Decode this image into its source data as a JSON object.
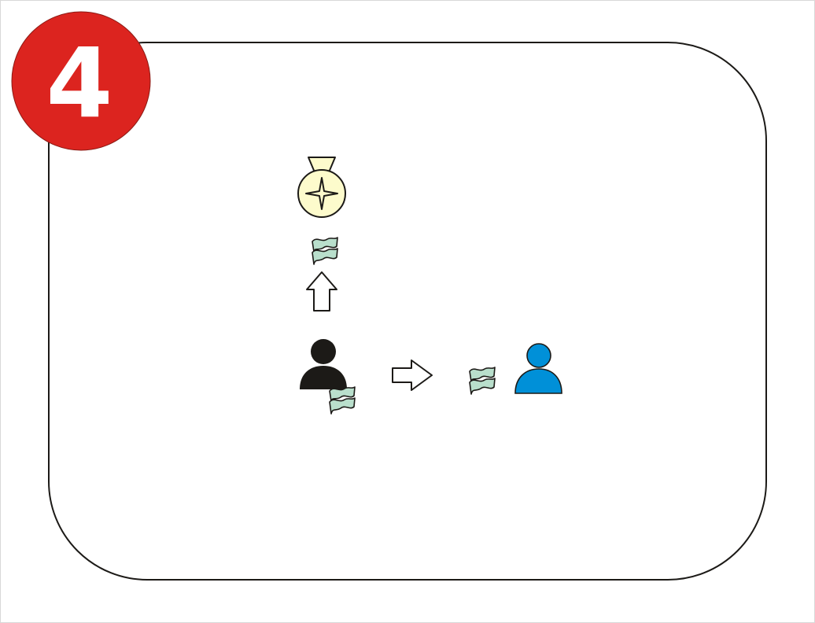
{
  "badge": {
    "number": "4",
    "color": "#dc241f"
  },
  "colors": {
    "money": "#b9dfcc",
    "medal": "#fdfbcc",
    "sender": "#1c1a17",
    "recipient": "#0090d8"
  },
  "icons": [
    "medal-icon",
    "money-icon",
    "arrow-up-icon",
    "person-icon",
    "arrow-right-icon"
  ]
}
